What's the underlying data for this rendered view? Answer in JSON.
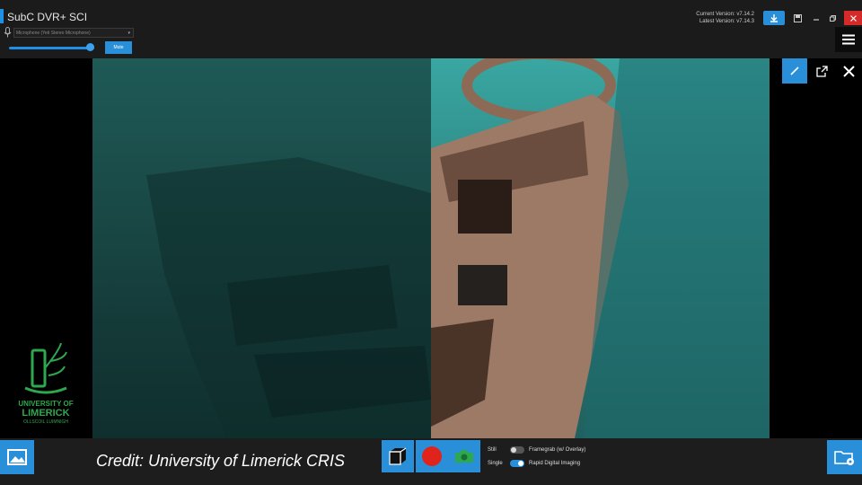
{
  "app": {
    "title": "SubC DVR+ SCI",
    "current_version": "Current Version: v7.14.2",
    "latest_version": "Latest Version: v7.14.3"
  },
  "audio": {
    "mic_device": "Microphone (Yeti Stereo Microphone)",
    "mute_label": "Mute",
    "volume_level_percent": 95
  },
  "logo": {
    "line1": "UNIVERSITY OF",
    "line2": "LIMERICK",
    "line3": "OLLSCOIL LUIMNIGH"
  },
  "bottom": {
    "credit": "Credit: University of Limerick CRIS",
    "still_label": "Still",
    "framegrab_label": "Framegrab (w/ Overlay)",
    "single_label": "Single",
    "rapid_label": "Rapid Digital Imaging"
  },
  "colors": {
    "accent": "#2a8fd9",
    "close": "#d42a2a",
    "record": "#e0241b",
    "camera": "#2ea84e",
    "logo": "#2ea84e"
  },
  "icons": [
    "microphone-icon",
    "download-icon",
    "save-icon",
    "minimize-icon",
    "maximize-icon",
    "close-icon",
    "hamburger-icon",
    "pencil-icon",
    "popout-icon",
    "exit-icon",
    "gallery-icon",
    "cube-icon",
    "record-icon",
    "camera-icon",
    "folder-settings-icon"
  ]
}
